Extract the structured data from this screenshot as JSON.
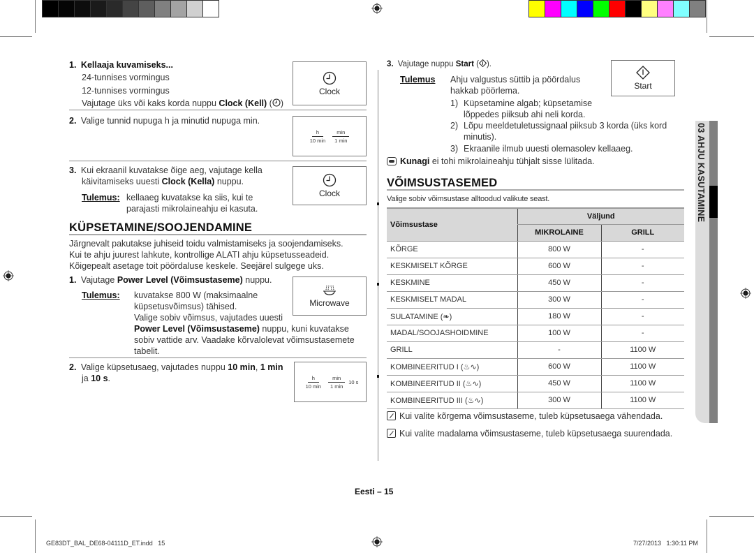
{
  "color_bars": {
    "grayscale": [
      "#000000",
      "#050505",
      "#0d0d0d",
      "#1a1a1a",
      "#2a2a2a",
      "#444444",
      "#5e5e5e",
      "#808080",
      "#a3a3a3",
      "#d0d0d0",
      "#ffffff"
    ],
    "process": [
      "#ffff00",
      "#ff00ff",
      "#00ffff",
      "#0000ff",
      "#00ff00",
      "#ff0000",
      "#000000",
      "#ffff80",
      "#ff80ff",
      "#80ffff",
      "#808080"
    ]
  },
  "left": {
    "step1": {
      "num": "1.",
      "title": "Kellaaja kuvamiseks...",
      "line1": "24-tunnises vormingus",
      "line2": "12-tunnises vormingus",
      "press_pre": "Vajutage üks või kaks korda nuppu ",
      "press_bold": "Clock (Kell)",
      "press_post": " (",
      "press_end": ")",
      "button_label": "Clock"
    },
    "step2": {
      "num": "2.",
      "text": "Valige tunnid nupuga h ja minutid nupuga min.",
      "keys": [
        {
          "top": "h",
          "bottom": "10 min"
        },
        {
          "top": "min",
          "bottom": "1 min"
        }
      ]
    },
    "step3": {
      "num": "3.",
      "line1": "Kui ekraanil kuvatakse õige aeg, vajutage kella",
      "line2_pre": "käivitamiseks uuesti ",
      "line2_bold": "Clock (Kella)",
      "line2_post": " nuppu.",
      "result_label": "Tulemus:",
      "result_line1": "kellaaeg kuvatakse ka siis, kui te",
      "result_line2": "parajasti mikrolaineahju ei kasuta.",
      "button_label": "Clock"
    },
    "cooking": {
      "title": "KÜPSETAMINE/SOOJENDAMINE",
      "intro1": "Järgnevalt pakutakse juhiseid toidu valmistamiseks ja soojendamiseks.",
      "intro2": "Kui te ahju juurest lahkute, kontrollige ALATI ahju küpsetusseadeid.",
      "intro3": "Kõigepealt asetage toit pöördaluse keskele. Seejärel sulgege uks.",
      "step1": {
        "num": "1.",
        "pre": "Vajutage ",
        "bold": "Power Level (Võimsustaseme)",
        "post": " nuppu.",
        "result_label": "Tulemus:",
        "r1": "kuvatakse 800 W (maksimaalne",
        "r2": "küpsetusvõimsus) tähised.",
        "r3": "Valige sobiv võimsus, vajutades uuesti",
        "r4_bold": "Power Level (Võimsustaseme)",
        "r4_post": " nuppu, kuni kuvatakse",
        "r5": "sobiv vattide arv. Vaadake kõrvalolevat võimsustasemete",
        "r6": "tabelit.",
        "button_label": "Microwave"
      },
      "step2": {
        "num": "2.",
        "pre": "Valige küpsetusaeg, vajutades nuppu ",
        "b1": "10 min",
        "sep": ", ",
        "b2": "1 min",
        "line2_pre": "ja ",
        "b3": "10 s",
        "line2_post": ".",
        "keys": [
          {
            "top": "h",
            "bottom": "10 min"
          },
          {
            "top": "min",
            "bottom": "1 min"
          }
        ],
        "extra_key": "10 s"
      }
    }
  },
  "right": {
    "step3": {
      "num": "3.",
      "pre": "Vajutage nuppu ",
      "bold": "Start",
      "post_open": " (",
      "post_close": ").",
      "result_label": "Tulemus",
      "r1": "Ahju valgustus süttib ja pöördalus",
      "r2": "hakkab pöörlema.",
      "items": [
        {
          "n": "1)",
          "l1": "Küpsetamine algab; küpsetamise",
          "l2": "lõppedes piiksub ahi neli korda."
        },
        {
          "n": "2)",
          "l1": "Lõpu meeldetuletussignaal piiksub 3 korda (üks kord",
          "l2": "minutis)."
        },
        {
          "n": "3)",
          "l1": "Ekraanile ilmub uuesti olemasolev kellaaeg.",
          "l2": ""
        }
      ],
      "button_label": "Start"
    },
    "caution": {
      "bold": "Kunagi",
      "text": " ei tohi mikrolaineahju tühjalt sisse lülitada."
    },
    "power": {
      "title": "VÕIMSUSTASEMED",
      "intro": "Valige sobiv võimsustase alltoodud valikute seast.",
      "table": {
        "col_level": "Võimsustase",
        "col_output": "Väljund",
        "col_micro": "MIKROLAINE",
        "col_grill": "GRILL",
        "rows": [
          {
            "level": "KÕRGE",
            "micro": "800 W",
            "grill": "-"
          },
          {
            "level": "KESKMISELT KÕRGE",
            "micro": "600 W",
            "grill": "-"
          },
          {
            "level": "KESKMINE",
            "micro": "450 W",
            "grill": "-"
          },
          {
            "level": "KESKMISELT MADAL",
            "micro": "300 W",
            "grill": "-"
          },
          {
            "level": "SULATAMINE (❧)",
            "micro": "180 W",
            "grill": "-"
          },
          {
            "level": "MADAL/SOOJASHOIDMINE",
            "micro": "100 W",
            "grill": "-"
          },
          {
            "level": "GRILL",
            "micro": "-",
            "grill": "1100 W"
          },
          {
            "level": "KOMBINEERITUD I (♨∿)",
            "micro": "600 W",
            "grill": "1100 W"
          },
          {
            "level": "KOMBINEERITUD II (♨∿)",
            "micro": "450 W",
            "grill": "1100 W"
          },
          {
            "level": "KOMBINEERITUD III (♨∿)",
            "micro": "300 W",
            "grill": "1100 W"
          }
        ]
      },
      "notes": [
        "Kui valite kõrgema võimsustaseme, tuleb küpsetusaega vähendada.",
        "Kui valite madalama võimsustaseme, tuleb küpsetusaega suurendada."
      ]
    }
  },
  "side_tab": {
    "label": "03  AHJU KASUTAMINE"
  },
  "footer": {
    "page": "Eesti – 15",
    "file": "GE83DT_BAL_DE68-04111D_ET.indd   15",
    "timestamp": "7/27/2013   1:30:11 PM"
  }
}
